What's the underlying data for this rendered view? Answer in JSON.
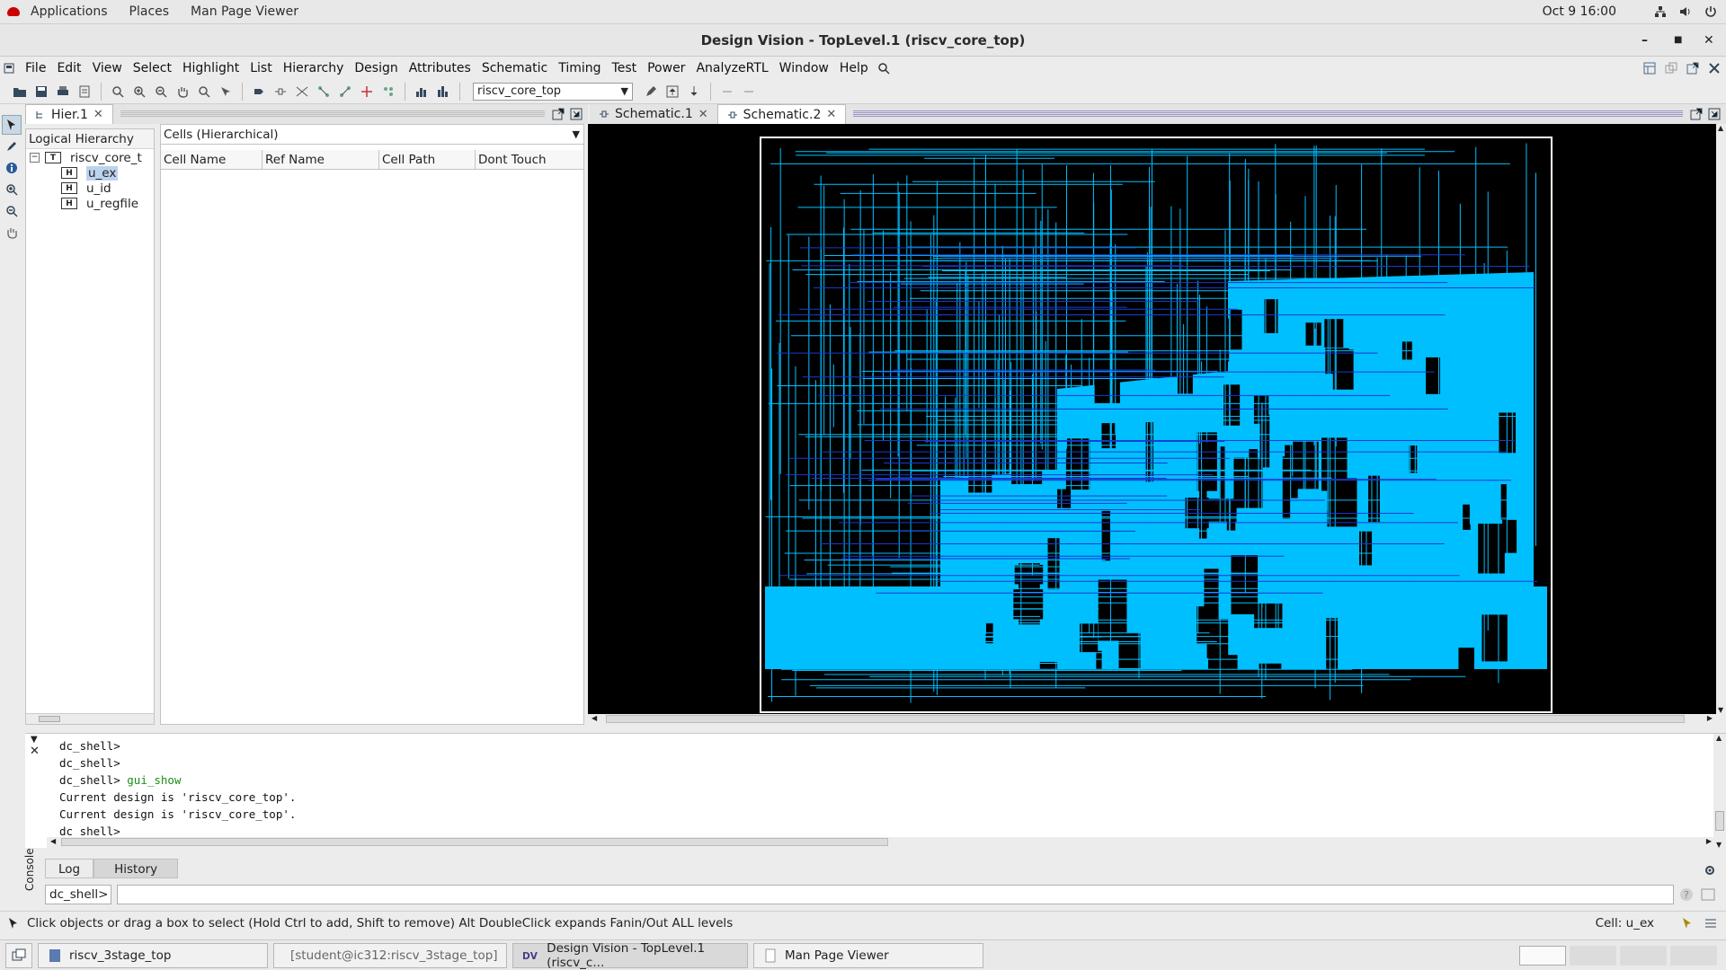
{
  "topbar": {
    "applications": "Applications",
    "places": "Places",
    "app_name": "Man Page Viewer",
    "clock": "Oct 9  16:00"
  },
  "window": {
    "title": "Design Vision - TopLevel.1 (riscv_core_top)"
  },
  "menu": {
    "items": [
      "File",
      "Edit",
      "View",
      "Select",
      "Highlight",
      "List",
      "Hierarchy",
      "Design",
      "Attributes",
      "Schematic",
      "Timing",
      "Test",
      "Power",
      "AnalyzeRTL",
      "Window",
      "Help"
    ]
  },
  "toolbar": {
    "design_select_value": "riscv_core_top"
  },
  "hier": {
    "tab_label": "Hier.1",
    "logical_title": "Logical Hierarchy",
    "tree": [
      {
        "badge": "T",
        "label": "riscv_core_t",
        "level": 0
      },
      {
        "badge": "H",
        "label": "u_ex",
        "level": 1
      },
      {
        "badge": "H",
        "label": "u_id",
        "level": 1
      },
      {
        "badge": "H",
        "label": "u_regfile",
        "level": 1
      }
    ],
    "cells_dropdown": "Cells (Hierarchical)",
    "columns": [
      "Cell Name",
      "Ref Name",
      "Cell Path",
      "Dont Touch"
    ]
  },
  "schematic": {
    "tabs": [
      "Schematic.1",
      "Schematic.2"
    ],
    "active_tab": "Schematic.2",
    "colors": {
      "background": "#000000",
      "wires": "#00bfff",
      "border": "#ffffff"
    }
  },
  "console": {
    "lines": [
      {
        "prompt": "dc_shell>",
        "cmd": ""
      },
      {
        "prompt": "dc_shell>",
        "cmd": ""
      },
      {
        "prompt": "dc_shell>",
        "cmd": "gui_show"
      },
      {
        "prompt": "",
        "cmd": "",
        "out": "Current design is 'riscv_core_top'."
      },
      {
        "prompt": "",
        "cmd": "",
        "out": "Current design is 'riscv_core_top'."
      },
      {
        "prompt": "dc_shell>",
        "cmd": ""
      }
    ],
    "tabs": [
      "Log",
      "History"
    ],
    "selected_tab": "History",
    "side_label": "Console",
    "prompt_label": "dc_shell>",
    "input_value": ""
  },
  "status": {
    "message": "Click objects or drag a box to select (Hold Ctrl to add, Shift to remove) Alt DoubleClick expands Fanin/Out ALL levels",
    "cell": "Cell: u_ex"
  },
  "taskbar": {
    "items": [
      {
        "label": "riscv_3stage_top",
        "icon": "folder-icon"
      },
      {
        "label": "[student@ic312:riscv_3stage_top]",
        "icon": "terminal-icon"
      },
      {
        "label": "Design Vision - TopLevel.1 (riscv_c...",
        "icon": "dv-icon"
      },
      {
        "label": "Man Page Viewer",
        "icon": "document-icon"
      }
    ],
    "active": 2
  }
}
